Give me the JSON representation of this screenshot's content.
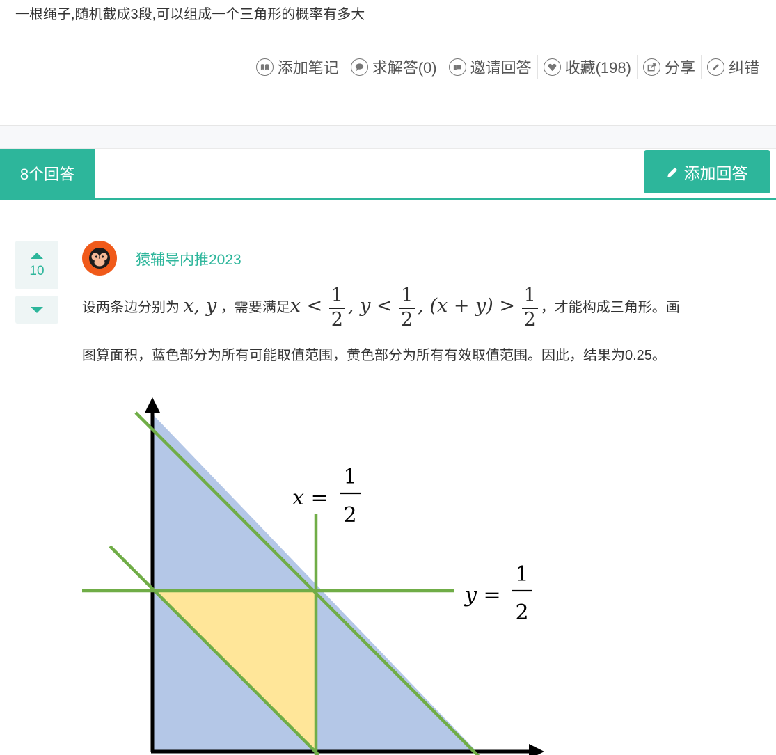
{
  "question": {
    "title": "一根绳子,随机截成3段,可以组成一个三角形的概率有多大"
  },
  "actions": [
    {
      "label": "添加笔记",
      "icon": "notebook-icon"
    },
    {
      "label": "求解答(0)",
      "icon": "speech-bubble-icon"
    },
    {
      "label": "邀请回答",
      "icon": "invite-hand-icon"
    },
    {
      "label": "收藏(198)",
      "icon": "heart-icon"
    },
    {
      "label": "分享",
      "icon": "share-icon"
    },
    {
      "label": "纠错",
      "icon": "pencil-icon"
    }
  ],
  "answers_bar": {
    "count_label": "8个回答",
    "add_label": "添加回答"
  },
  "answer": {
    "votes": "10",
    "author": "猿辅导内推2023",
    "text_intro": "设两条边分别为",
    "vars": "x, y",
    "text_need": "，需要满足",
    "cond_x": "x <",
    "cond_y": ", y <",
    "cond_sum": ", (x + y) >",
    "frac_num": "1",
    "frac_den": "2",
    "text_tail": "，才能构成三角形。画",
    "line2": "图算面积，蓝色部分为所有可能取值范围，黄色部分为所有有效取值范围。因此，结果为0.25。"
  },
  "diagram": {
    "label_x_lhs": "x =",
    "label_y_lhs": "y =",
    "label_num": "1",
    "label_den": "2",
    "colors": {
      "blue_region": "#b4c7e7",
      "yellow_region": "#ffe699",
      "green_lines": "#70ad47",
      "axes": "#000000",
      "accent": "#2db69b"
    }
  }
}
